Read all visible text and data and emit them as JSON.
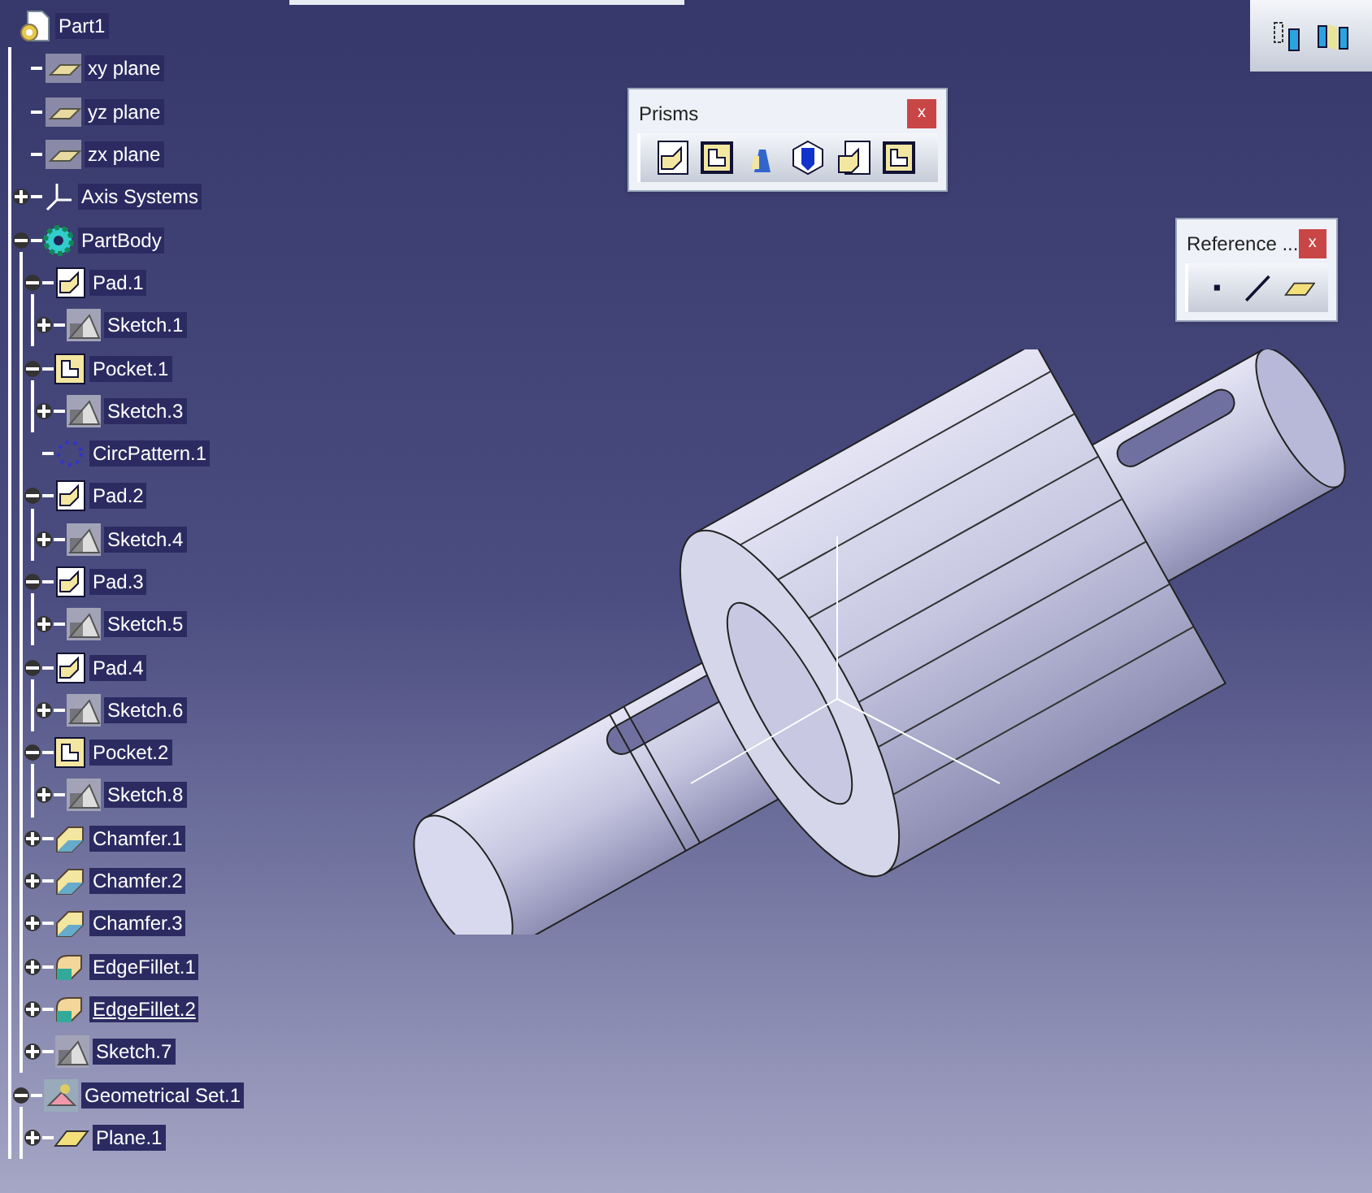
{
  "tree": {
    "label": "Part1",
    "kind": "part",
    "in_work": false,
    "children": [
      {
        "label": "xy plane",
        "kind": "plane",
        "in_work": false
      },
      {
        "label": "yz plane",
        "kind": "plane",
        "in_work": false
      },
      {
        "label": "zx plane",
        "kind": "plane",
        "in_work": false
      },
      {
        "label": "Axis Systems",
        "kind": "axis",
        "expanded": false,
        "in_work": false
      },
      {
        "label": "PartBody",
        "kind": "body",
        "expanded": true,
        "in_work": false,
        "children": [
          {
            "label": "Pad.1",
            "kind": "pad",
            "expanded": true,
            "in_work": false,
            "children": [
              {
                "label": "Sketch.1",
                "kind": "sketch",
                "expanded": false,
                "in_work": false
              }
            ]
          },
          {
            "label": "Pocket.1",
            "kind": "pocket",
            "expanded": true,
            "in_work": false,
            "children": [
              {
                "label": "Sketch.3",
                "kind": "sketch",
                "expanded": false,
                "in_work": false
              }
            ]
          },
          {
            "label": "CircPattern.1",
            "kind": "pattern",
            "in_work": false
          },
          {
            "label": "Pad.2",
            "kind": "pad",
            "expanded": true,
            "in_work": false,
            "children": [
              {
                "label": "Sketch.4",
                "kind": "sketch",
                "expanded": false,
                "in_work": false
              }
            ]
          },
          {
            "label": "Pad.3",
            "kind": "pad",
            "expanded": true,
            "in_work": false,
            "children": [
              {
                "label": "Sketch.5",
                "kind": "sketch",
                "expanded": false,
                "in_work": false
              }
            ]
          },
          {
            "label": "Pad.4",
            "kind": "pad",
            "expanded": true,
            "in_work": false,
            "children": [
              {
                "label": "Sketch.6",
                "kind": "sketch",
                "expanded": false,
                "in_work": false
              }
            ]
          },
          {
            "label": "Pocket.2",
            "kind": "pocket",
            "expanded": true,
            "in_work": false,
            "children": [
              {
                "label": "Sketch.8",
                "kind": "sketch",
                "expanded": false,
                "in_work": false
              }
            ]
          },
          {
            "label": "Chamfer.1",
            "kind": "chamfer",
            "expanded": false,
            "in_work": false
          },
          {
            "label": "Chamfer.2",
            "kind": "chamfer",
            "expanded": false,
            "in_work": false
          },
          {
            "label": "Chamfer.3",
            "kind": "chamfer",
            "expanded": false,
            "in_work": false
          },
          {
            "label": "EdgeFillet.1",
            "kind": "fillet",
            "expanded": false,
            "in_work": false
          },
          {
            "label": "EdgeFillet.2",
            "kind": "fillet",
            "expanded": false,
            "in_work": true
          },
          {
            "label": "Sketch.7",
            "kind": "sketch",
            "expanded": false,
            "in_work": false
          }
        ]
      },
      {
        "label": "Geometrical Set.1",
        "kind": "geoset",
        "expanded": true,
        "in_work": false,
        "children": [
          {
            "label": "Plane.1",
            "kind": "planefeature",
            "expanded": false,
            "in_work": false
          }
        ]
      }
    ]
  },
  "toolbars": [
    {
      "title": "Prisms",
      "kind": "prisms",
      "close": "x"
    },
    {
      "title": "Reference ...",
      "kind": "reference",
      "close": "x"
    }
  ]
}
